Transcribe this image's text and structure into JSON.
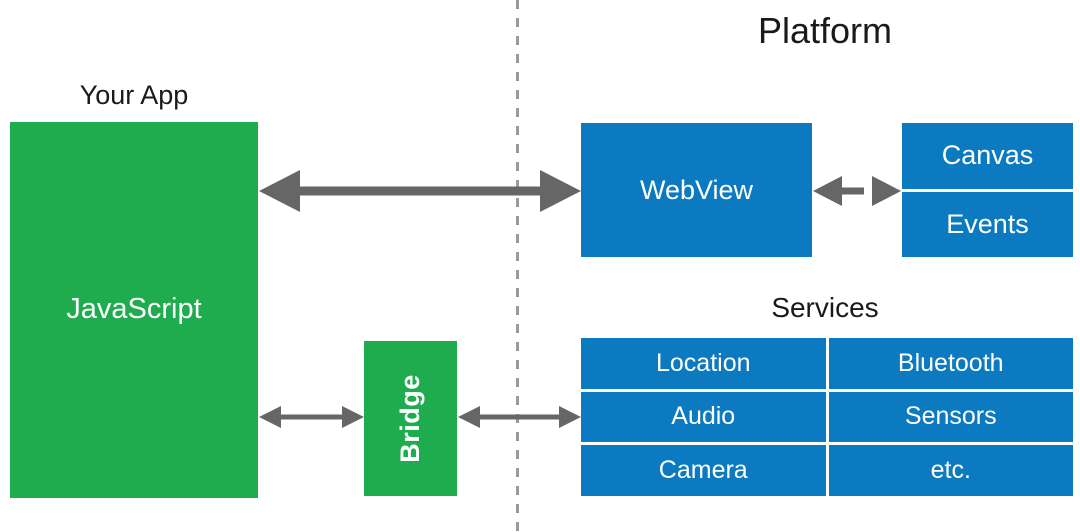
{
  "diagram": {
    "title_app": "Your App",
    "title_platform": "Platform",
    "title_services": "Services",
    "colors": {
      "app_green": "#1fac4e",
      "platform_blue": "#0c7ac0",
      "arrow_gray": "#666666",
      "divider_gray": "#999999",
      "text_dark": "#1a1a1a",
      "text_light": "#ffffff",
      "background": "#ffffff"
    }
  },
  "app_side": {
    "javascript_box": "JavaScript",
    "bridge_box": "Bridge"
  },
  "platform_side": {
    "webview_box": "WebView",
    "canvas_events": [
      "Canvas",
      "Events"
    ]
  },
  "services": {
    "heading": "Services",
    "rows": [
      {
        "left": "Location",
        "right": "Bluetooth"
      },
      {
        "left": "Audio",
        "right": "Sensors"
      },
      {
        "left": "Camera",
        "right": "etc."
      }
    ]
  },
  "connectors": {
    "js_to_webview": "bidirectional-arrow",
    "webview_to_canvas_events": "bidirectional-arrow",
    "js_to_bridge": "bidirectional-arrow",
    "bridge_to_services": "bidirectional-arrow",
    "boundary": "vertical-dashed-divider"
  }
}
